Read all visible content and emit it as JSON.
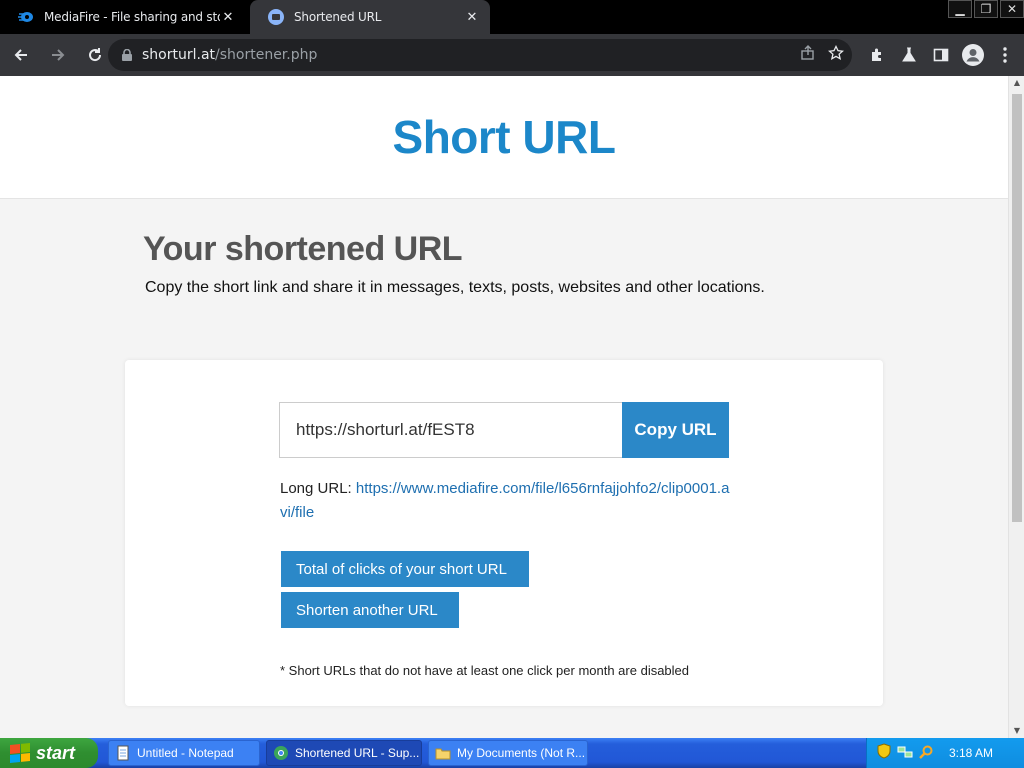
{
  "browser": {
    "tabs": [
      {
        "title": "MediaFire - File sharing and storage",
        "active": false
      },
      {
        "title": "Shortened URL",
        "active": true
      }
    ],
    "address": {
      "host": "shorturl.at",
      "path": "/shortener.php"
    }
  },
  "page": {
    "site_title": "Short URL",
    "heading": "Your shortened URL",
    "subheading": "Copy the short link and share it in messages, texts, posts, websites and other locations.",
    "short_url": "https://shorturl.at/fEST8",
    "copy_label": "Copy URL",
    "long_url_label": "Long URL:",
    "long_url": "https://www.mediafire.com/file/l656rnfajjohfo2/clip0001.avi/file",
    "clicks_label": "Total of clicks of your short URL",
    "another_label": "Shorten another URL",
    "note": "* Short URLs that do not have at least one click per month are disabled"
  },
  "colors": {
    "brand": "#1c87c9",
    "button": "#2b88c8",
    "link": "#1e6fb0"
  },
  "taskbar": {
    "start_label": "start",
    "tasks": [
      {
        "label": "Untitled - Notepad",
        "icon": "notepad-icon"
      },
      {
        "label": "Shortened URL - Sup...",
        "icon": "browser-icon"
      },
      {
        "label": "My Documents (Not R...",
        "icon": "folder-icon"
      }
    ],
    "clock": "3:18 AM"
  }
}
